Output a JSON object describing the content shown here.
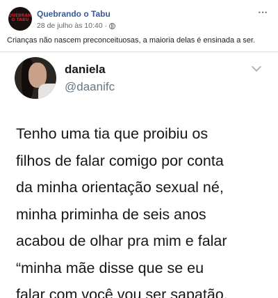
{
  "post": {
    "page_name": "Quebrando o Tabu",
    "page_logo_text": "QUEBRANDO O TABU",
    "date": "28 de julho às 10:40",
    "separator": "·",
    "caption": "Crianças não nascem preconceituosas, a maioria delas é ensinada a ser.",
    "more_icon": "⋯"
  },
  "tweet": {
    "display_name": "daniela",
    "handle": "@daanifc",
    "lines": [
      "Tenho uma tia que proibiu os",
      "filhos de falar comigo por conta",
      "da minha orientação sexual né,",
      "minha priminha de seis anos",
      "acabou de olhar pra mim e falar",
      "“minha mãe disse que se eu",
      "falar com você vou ser sapatão,"
    ]
  },
  "colors": {
    "page_name": "#385898",
    "meta": "#616770",
    "handle": "#657786",
    "text": "#14171a"
  }
}
